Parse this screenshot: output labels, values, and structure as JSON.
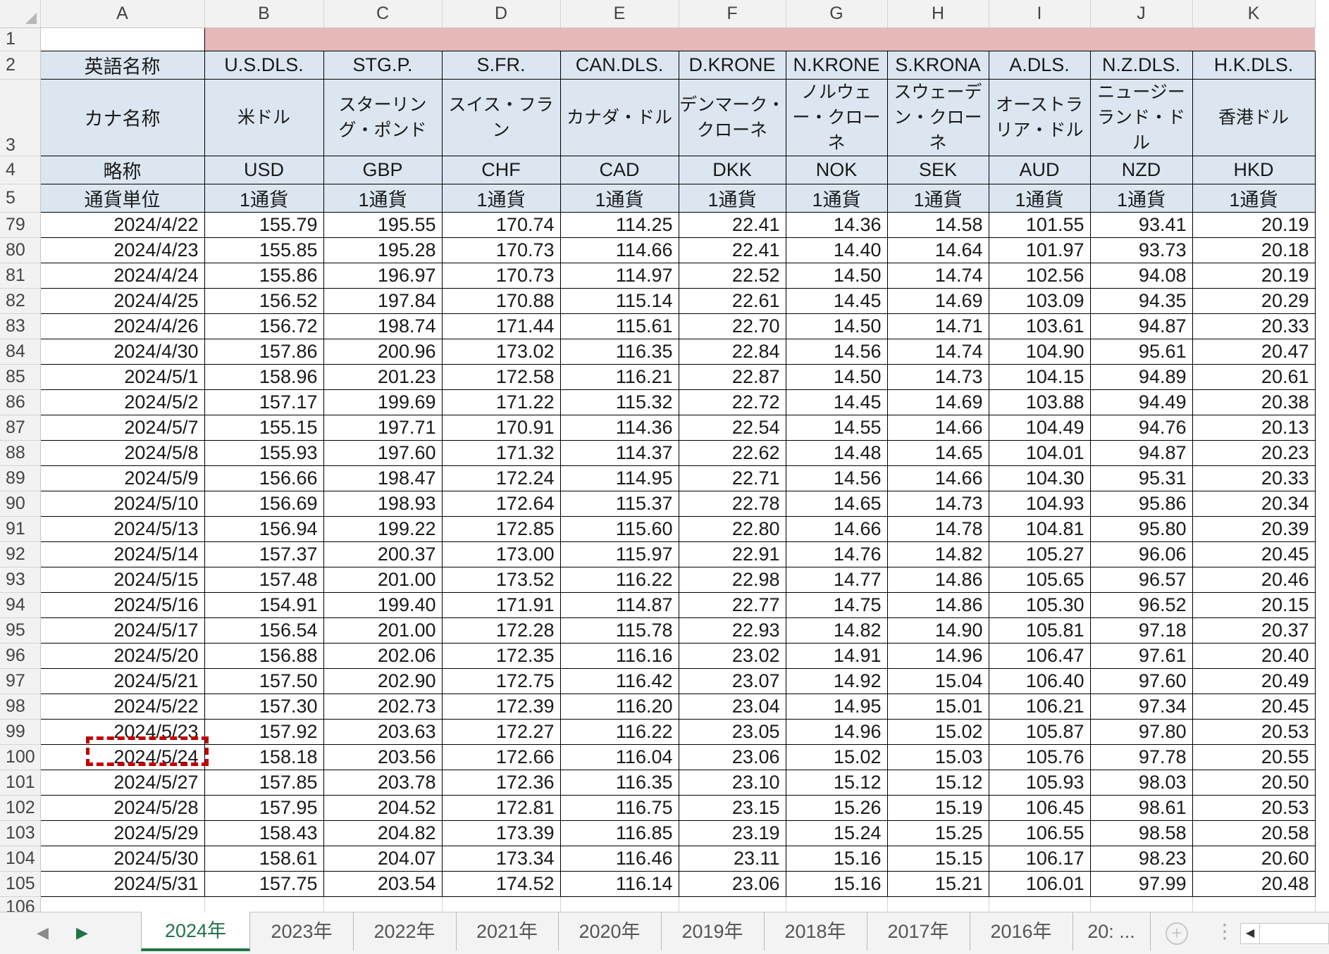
{
  "columns": [
    "A",
    "B",
    "C",
    "D",
    "E",
    "F",
    "G",
    "H",
    "I",
    "J",
    "K"
  ],
  "title_row": {
    "row": "1"
  },
  "header_rows": [
    {
      "row": "2",
      "label": "英語名称",
      "values": [
        "U.S.DLS.",
        "STG.P.",
        "S.FR.",
        "CAN.DLS.",
        "D.KRONE",
        "N.KRONE",
        "S.KRONA",
        "A.DLS.",
        "N.Z.DLS.",
        "H.K.DLS."
      ]
    },
    {
      "row": "3",
      "label": "カナ名称",
      "values": [
        "米ドル",
        "スターリング・ポンド",
        "スイス・フラン",
        "カナダ・ドル",
        "デンマーク・クローネ",
        "ノルウェー・クローネ",
        "スウェーデン・クローネ",
        "オーストラリア・ドル",
        "ニュージーランド・ドル",
        "香港ドル"
      ]
    },
    {
      "row": "4",
      "label": "略称",
      "values": [
        "USD",
        "GBP",
        "CHF",
        "CAD",
        "DKK",
        "NOK",
        "SEK",
        "AUD",
        "NZD",
        "HKD"
      ]
    },
    {
      "row": "5",
      "label": "通貨単位",
      "values": [
        "1通貨",
        "1通貨",
        "1通貨",
        "1通貨",
        "1通貨",
        "1通貨",
        "1通貨",
        "1通貨",
        "1通貨",
        "1通貨"
      ]
    }
  ],
  "rows": [
    {
      "row": "79",
      "date": "2024/4/22",
      "values": [
        "155.79",
        "195.55",
        "170.74",
        "114.25",
        "22.41",
        "14.36",
        "14.58",
        "101.55",
        "93.41",
        "20.19"
      ]
    },
    {
      "row": "80",
      "date": "2024/4/23",
      "values": [
        "155.85",
        "195.28",
        "170.73",
        "114.66",
        "22.41",
        "14.40",
        "14.64",
        "101.97",
        "93.73",
        "20.18"
      ]
    },
    {
      "row": "81",
      "date": "2024/4/24",
      "values": [
        "155.86",
        "196.97",
        "170.73",
        "114.97",
        "22.52",
        "14.50",
        "14.74",
        "102.56",
        "94.08",
        "20.19"
      ]
    },
    {
      "row": "82",
      "date": "2024/4/25",
      "values": [
        "156.52",
        "197.84",
        "170.88",
        "115.14",
        "22.61",
        "14.45",
        "14.69",
        "103.09",
        "94.35",
        "20.29"
      ]
    },
    {
      "row": "83",
      "date": "2024/4/26",
      "values": [
        "156.72",
        "198.74",
        "171.44",
        "115.61",
        "22.70",
        "14.50",
        "14.71",
        "103.61",
        "94.87",
        "20.33"
      ]
    },
    {
      "row": "84",
      "date": "2024/4/30",
      "values": [
        "157.86",
        "200.96",
        "173.02",
        "116.35",
        "22.84",
        "14.56",
        "14.74",
        "104.90",
        "95.61",
        "20.47"
      ]
    },
    {
      "row": "85",
      "date": "2024/5/1",
      "values": [
        "158.96",
        "201.23",
        "172.58",
        "116.21",
        "22.87",
        "14.50",
        "14.73",
        "104.15",
        "94.89",
        "20.61"
      ]
    },
    {
      "row": "86",
      "date": "2024/5/2",
      "values": [
        "157.17",
        "199.69",
        "171.22",
        "115.32",
        "22.72",
        "14.45",
        "14.69",
        "103.88",
        "94.49",
        "20.38"
      ]
    },
    {
      "row": "87",
      "date": "2024/5/7",
      "values": [
        "155.15",
        "197.71",
        "170.91",
        "114.36",
        "22.54",
        "14.55",
        "14.66",
        "104.49",
        "94.76",
        "20.13"
      ]
    },
    {
      "row": "88",
      "date": "2024/5/8",
      "values": [
        "155.93",
        "197.60",
        "171.32",
        "114.37",
        "22.62",
        "14.48",
        "14.65",
        "104.01",
        "94.87",
        "20.23"
      ]
    },
    {
      "row": "89",
      "date": "2024/5/9",
      "values": [
        "156.66",
        "198.47",
        "172.24",
        "114.95",
        "22.71",
        "14.56",
        "14.66",
        "104.30",
        "95.31",
        "20.33"
      ]
    },
    {
      "row": "90",
      "date": "2024/5/10",
      "values": [
        "156.69",
        "198.93",
        "172.64",
        "115.37",
        "22.78",
        "14.65",
        "14.73",
        "104.93",
        "95.86",
        "20.34"
      ]
    },
    {
      "row": "91",
      "date": "2024/5/13",
      "values": [
        "156.94",
        "199.22",
        "172.85",
        "115.60",
        "22.80",
        "14.66",
        "14.78",
        "104.81",
        "95.80",
        "20.39"
      ]
    },
    {
      "row": "92",
      "date": "2024/5/14",
      "values": [
        "157.37",
        "200.37",
        "173.00",
        "115.97",
        "22.91",
        "14.76",
        "14.82",
        "105.27",
        "96.06",
        "20.45"
      ]
    },
    {
      "row": "93",
      "date": "2024/5/15",
      "values": [
        "157.48",
        "201.00",
        "173.52",
        "116.22",
        "22.98",
        "14.77",
        "14.86",
        "105.65",
        "96.57",
        "20.46"
      ]
    },
    {
      "row": "94",
      "date": "2024/5/16",
      "values": [
        "154.91",
        "199.40",
        "171.91",
        "114.87",
        "22.77",
        "14.75",
        "14.86",
        "105.30",
        "96.52",
        "20.15"
      ]
    },
    {
      "row": "95",
      "date": "2024/5/17",
      "values": [
        "156.54",
        "201.00",
        "172.28",
        "115.78",
        "22.93",
        "14.82",
        "14.90",
        "105.81",
        "97.18",
        "20.37"
      ]
    },
    {
      "row": "96",
      "date": "2024/5/20",
      "values": [
        "156.88",
        "202.06",
        "172.35",
        "116.16",
        "23.02",
        "14.91",
        "14.96",
        "106.47",
        "97.61",
        "20.40"
      ]
    },
    {
      "row": "97",
      "date": "2024/5/21",
      "values": [
        "157.50",
        "202.90",
        "172.75",
        "116.42",
        "23.07",
        "14.92",
        "15.04",
        "106.40",
        "97.60",
        "20.49"
      ]
    },
    {
      "row": "98",
      "date": "2024/5/22",
      "values": [
        "157.30",
        "202.73",
        "172.39",
        "116.20",
        "23.04",
        "14.95",
        "15.01",
        "106.21",
        "97.34",
        "20.45"
      ]
    },
    {
      "row": "99",
      "date": "2024/5/23",
      "values": [
        "157.92",
        "203.63",
        "172.27",
        "116.22",
        "23.05",
        "14.96",
        "15.02",
        "105.87",
        "97.80",
        "20.53"
      ]
    },
    {
      "row": "100",
      "date": "2024/5/24",
      "values": [
        "158.18",
        "203.56",
        "172.66",
        "116.04",
        "23.06",
        "15.02",
        "15.03",
        "105.76",
        "97.78",
        "20.55"
      ]
    },
    {
      "row": "101",
      "date": "2024/5/27",
      "values": [
        "157.85",
        "203.78",
        "172.36",
        "116.35",
        "23.10",
        "15.12",
        "15.12",
        "105.93",
        "98.03",
        "20.50"
      ]
    },
    {
      "row": "102",
      "date": "2024/5/28",
      "values": [
        "157.95",
        "204.52",
        "172.81",
        "116.75",
        "23.15",
        "15.26",
        "15.19",
        "106.45",
        "98.61",
        "20.53"
      ]
    },
    {
      "row": "103",
      "date": "2024/5/29",
      "values": [
        "158.43",
        "204.82",
        "173.39",
        "116.85",
        "23.19",
        "15.24",
        "15.25",
        "106.55",
        "98.58",
        "20.58"
      ]
    },
    {
      "row": "104",
      "date": "2024/5/30",
      "values": [
        "158.61",
        "204.07",
        "173.34",
        "116.46",
        "23.11",
        "15.16",
        "15.15",
        "106.17",
        "98.23",
        "20.60"
      ]
    },
    {
      "row": "105",
      "date": "2024/5/31",
      "values": [
        "157.75",
        "203.54",
        "174.52",
        "116.14",
        "23.06",
        "15.16",
        "15.21",
        "106.01",
        "97.99",
        "20.48"
      ]
    }
  ],
  "empty_row": "106",
  "sheet_tabs": [
    "2024年",
    "2023年",
    "2022年",
    "2021年",
    "2020年",
    "2019年",
    "2018年",
    "2017年",
    "2016年",
    "20: ..."
  ],
  "active_tab": "2024年",
  "highlighted_cell": "A100",
  "colors": {
    "header_fill": "#dce6f1",
    "title_fill": "#e6b8b7",
    "active_tab_text": "#217346",
    "highlight_border": "#c00000"
  },
  "icons": {
    "nav_prev": "triangle-left-icon",
    "nav_next": "triangle-right-icon",
    "add_sheet": "plus-circle-icon",
    "more": "vertical-dots-icon"
  }
}
